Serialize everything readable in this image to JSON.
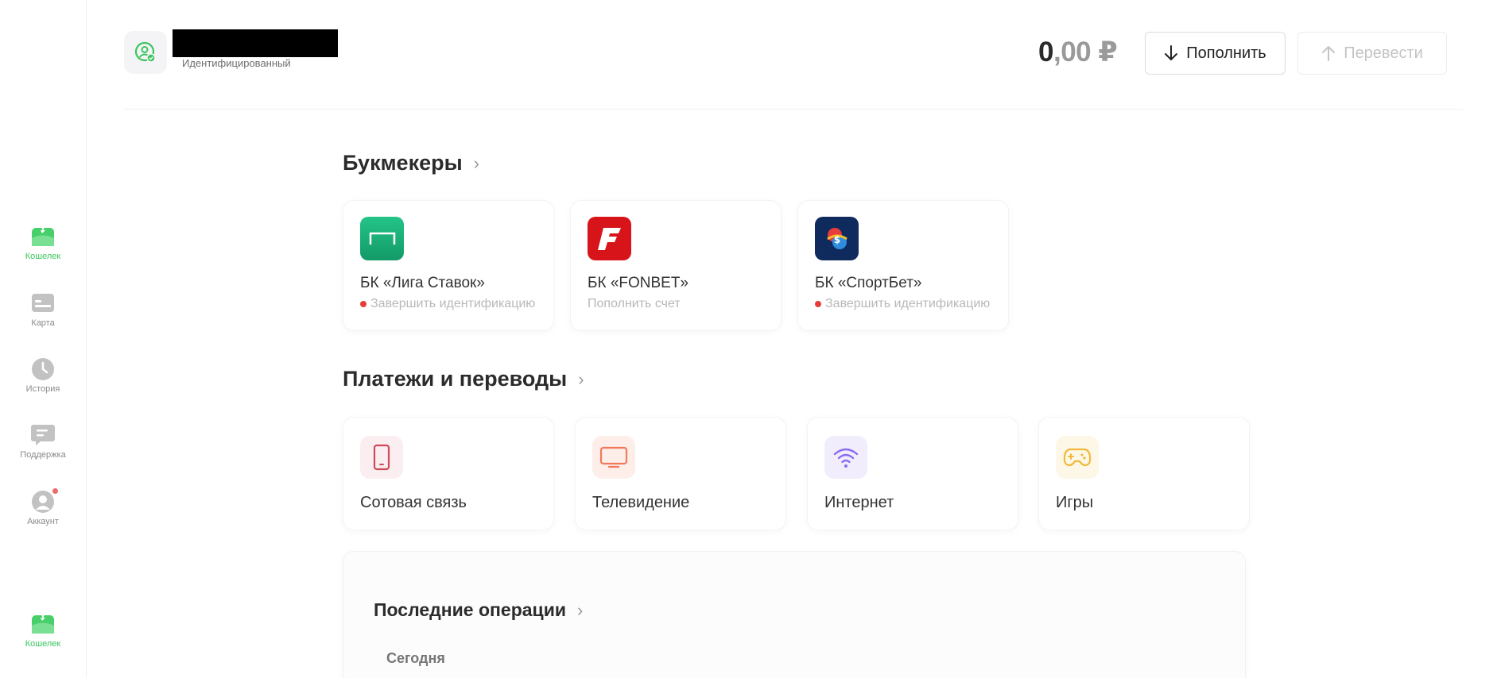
{
  "sidebar": {
    "items": [
      {
        "label": "Кошелек",
        "icon": "wallet-icon"
      },
      {
        "label": "Карта",
        "icon": "card-icon"
      },
      {
        "label": "История",
        "icon": "clock-icon"
      },
      {
        "label": "Поддержка",
        "icon": "chat-icon"
      },
      {
        "label": "Аккаунт",
        "icon": "user-icon"
      }
    ],
    "bottom": {
      "label": "Кошелек",
      "icon": "wallet-icon"
    }
  },
  "header": {
    "user_name": "",
    "user_status": "Идентифицированный",
    "balance_int": "0",
    "balance_frac": ",00 ₽",
    "deposit_label": "Пополнить",
    "transfer_label": "Перевести"
  },
  "bookmakers": {
    "title": "Букмекеры",
    "items": [
      {
        "name": "БК «Лига Ставок»",
        "sub": "Завершить идентификацию",
        "alert": true,
        "color": "#1fb27a"
      },
      {
        "name": "БК «FONBET»",
        "sub": "Пополнить счет",
        "alert": false,
        "color": "#d8141b"
      },
      {
        "name": "БК «СпортБет»",
        "sub": "Завершить идентификацию",
        "alert": true,
        "color": "#0f2a5c"
      }
    ]
  },
  "payments": {
    "title": "Платежи и переводы",
    "items": [
      {
        "name": "Сотовая связь",
        "icon": "phone-icon",
        "color": "#cf4a5c"
      },
      {
        "name": "Телевидение",
        "icon": "tv-icon",
        "color": "#f07a5a"
      },
      {
        "name": "Интернет",
        "icon": "wifi-icon",
        "color": "#8a6cf0"
      },
      {
        "name": "Игры",
        "icon": "gamepad-icon",
        "color": "#f0b93a"
      }
    ]
  },
  "operations": {
    "title": "Последние операции",
    "today": "Сегодня"
  },
  "colors": {
    "accent": "#3cc55e",
    "alert": "#ea3b3b"
  }
}
